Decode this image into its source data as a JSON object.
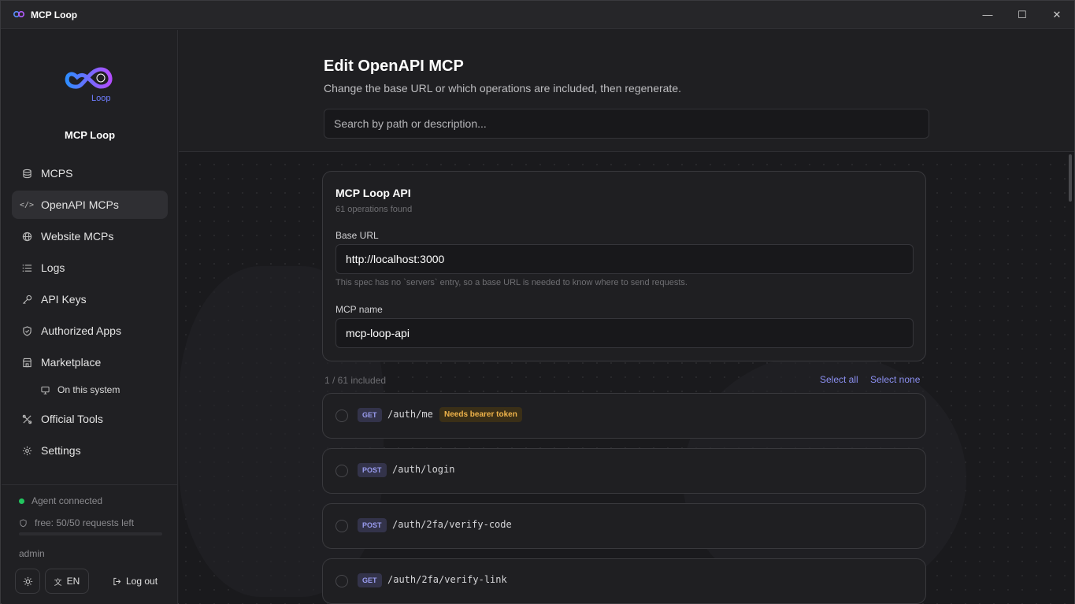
{
  "window": {
    "title": "MCP Loop"
  },
  "sidebar": {
    "brand": "MCP Loop",
    "items": [
      {
        "label": "MCPS",
        "icon": "database-icon"
      },
      {
        "label": "OpenAPI MCPs",
        "icon": "code-icon",
        "active": true
      },
      {
        "label": "Website MCPs",
        "icon": "globe-icon"
      },
      {
        "label": "Logs",
        "icon": "list-icon"
      },
      {
        "label": "API Keys",
        "icon": "key-icon"
      },
      {
        "label": "Authorized Apps",
        "icon": "shield-check-icon"
      },
      {
        "label": "Marketplace",
        "icon": "store-icon"
      },
      {
        "label": "Official Tools",
        "icon": "tools-icon"
      },
      {
        "label": "Settings",
        "icon": "gear-icon"
      }
    ],
    "sub_item": {
      "label": "On this system",
      "icon": "monitor-icon"
    },
    "status": "Agent connected",
    "quota": "free: 50/50 requests left",
    "user": "admin",
    "lang": "EN",
    "logout": "Log out"
  },
  "header": {
    "title": "Edit OpenAPI MCP",
    "subtitle": "Change the base URL or which operations are included, then regenerate.",
    "search_placeholder": "Search by path or description..."
  },
  "api": {
    "name": "MCP Loop API",
    "count": "61 operations found",
    "base_url_label": "Base URL",
    "base_url": "http://localhost:3000",
    "hint": "This spec has no `servers` entry, so a base URL is needed to know where to send requests.",
    "mcp_name_label": "MCP name",
    "mcp_name": "mcp-loop-api"
  },
  "operations_meta": {
    "included": "1 / 61 included",
    "select_all": "Select all",
    "select_none": "Select none"
  },
  "operations": [
    {
      "method": "GET",
      "path": "/auth/me",
      "badge": "Needs bearer token"
    },
    {
      "method": "POST",
      "path": "/auth/login"
    },
    {
      "method": "POST",
      "path": "/auth/2fa/verify-code"
    },
    {
      "method": "GET",
      "path": "/auth/2fa/verify-link"
    }
  ],
  "colors": {
    "accent": "#8b8ff0",
    "success": "#22c55e",
    "warning": "#f0b44a"
  }
}
